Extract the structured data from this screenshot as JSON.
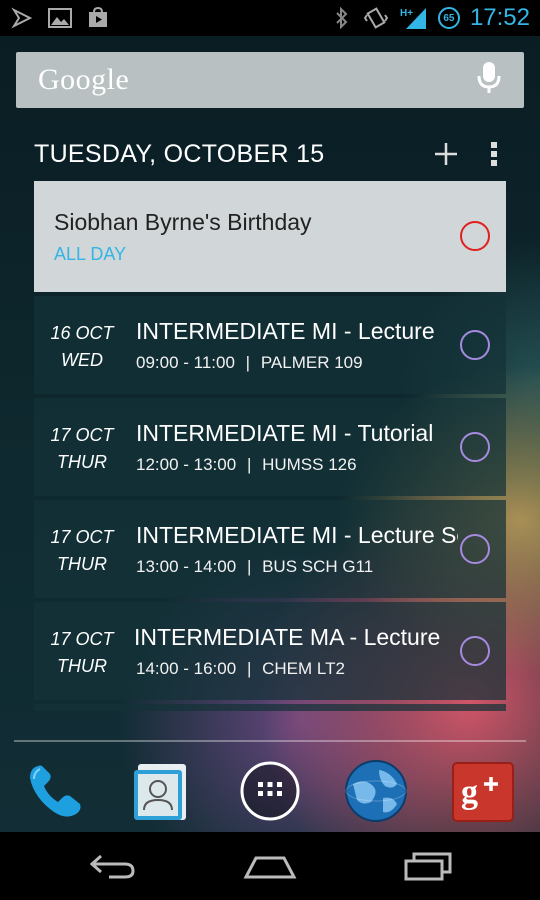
{
  "status_bar": {
    "time": "17:52",
    "network": "H+",
    "battery_badge": "65",
    "icons": [
      "notification-icon",
      "image-icon",
      "play-store-icon",
      "bluetooth-icon",
      "vibrate-icon",
      "signal-icon",
      "battery-icon"
    ]
  },
  "search": {
    "logo": "Google",
    "mic_icon": "mic-icon"
  },
  "calendar": {
    "date_header": "TUESDAY, OCTOBER 15",
    "add_icon": "plus-icon",
    "menu_icon": "overflow-menu-icon",
    "all_day_event": {
      "title": "Siobhan Byrne's Birthday",
      "subtitle": "ALL DAY",
      "circle_color": "#e02020"
    },
    "events": [
      {
        "date": "16 OCT",
        "day": "WED",
        "title": "INTERMEDIATE MI - Lecture",
        "time": "09:00 - 11:00",
        "separator": "|",
        "location": "PALMER 109"
      },
      {
        "date": "17 OCT",
        "day": "THUR",
        "title": "INTERMEDIATE MI - Tutorial",
        "time": "12:00 - 13:00",
        "separator": "|",
        "location": "HUMSS 126"
      },
      {
        "date": "17 OCT",
        "day": "THUR",
        "title": "INTERMEDIATE MI - Lecture Series",
        "time": "13:00 - 14:00",
        "separator": "|",
        "location": "BUS SCH G11"
      },
      {
        "date": "17 OCT",
        "day": "THUR",
        "title": "INTERMEDIATE MA - Lecture",
        "time": "14:00 - 16:00",
        "separator": "|",
        "location": "CHEM LT2"
      }
    ],
    "event_circle_color": "#a58ade"
  },
  "dock": {
    "apps": [
      "phone-icon",
      "contacts-icon",
      "app-drawer-icon",
      "browser-globe-icon",
      "google-plus-icon"
    ]
  },
  "nav": {
    "buttons": [
      "back-icon",
      "home-icon",
      "recents-icon"
    ]
  },
  "colors": {
    "accent": "#33b5e5",
    "allday_bg": "#d1d6d8",
    "status_bar_bg": "#000000"
  }
}
